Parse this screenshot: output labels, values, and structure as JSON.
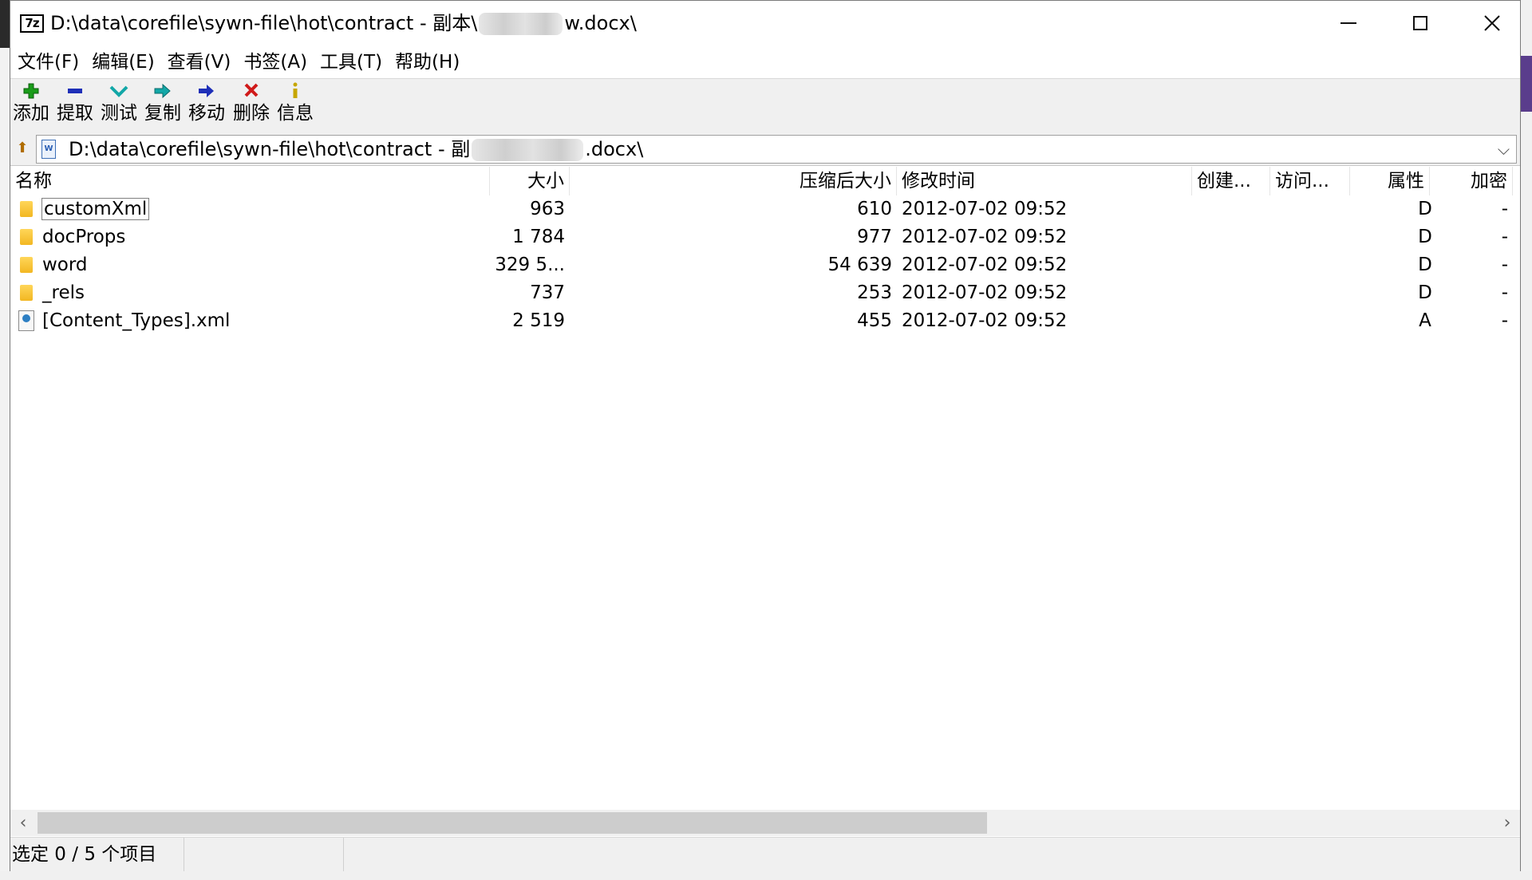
{
  "window": {
    "title_prefix": "D:\\data\\corefile\\sywn-file\\hot\\contract - 副本\\",
    "title_suffix": "w.docx\\",
    "app_icon": "7z"
  },
  "menu": [
    "文件(F)",
    "编辑(E)",
    "查看(V)",
    "书签(A)",
    "工具(T)",
    "帮助(H)"
  ],
  "toolbar": [
    {
      "label": "添加",
      "icon": "plus-icon",
      "color": "#1a9c1a"
    },
    {
      "label": "提取",
      "icon": "minus-icon",
      "color": "#1e2fb8"
    },
    {
      "label": "测试",
      "icon": "check-down-icon",
      "color": "#12a7a7"
    },
    {
      "label": "复制",
      "icon": "copy-arrow-icon",
      "color": "#12a7a7"
    },
    {
      "label": "移动",
      "icon": "arrow-right-icon",
      "color": "#1e2fb8"
    },
    {
      "label": "删除",
      "icon": "delete-x-icon",
      "color": "#d01a1a"
    },
    {
      "label": "信息",
      "icon": "info-icon",
      "color": "#c6a600"
    }
  ],
  "address": {
    "prefix": "D:\\data\\corefile\\sywn-file\\hot\\contract - 副",
    "suffix": ".docx\\"
  },
  "columns": [
    "名称",
    "大小",
    "压缩后大小",
    "修改时间",
    "创建...",
    "访问...",
    "属性",
    "加密"
  ],
  "rows": [
    {
      "name": "customXml",
      "size": "963",
      "packed": "610",
      "modified": "2012-07-02 09:52",
      "created": "",
      "accessed": "",
      "attr": "D",
      "encrypted": "-",
      "type": "folder"
    },
    {
      "name": "docProps",
      "size": "1 784",
      "packed": "977",
      "modified": "2012-07-02 09:52",
      "created": "",
      "accessed": "",
      "attr": "D",
      "encrypted": "-",
      "type": "folder"
    },
    {
      "name": "word",
      "size": "329 5...",
      "packed": "54 639",
      "modified": "2012-07-02 09:52",
      "created": "",
      "accessed": "",
      "attr": "D",
      "encrypted": "-",
      "type": "folder"
    },
    {
      "name": "_rels",
      "size": "737",
      "packed": "253",
      "modified": "2012-07-02 09:52",
      "created": "",
      "accessed": "",
      "attr": "D",
      "encrypted": "-",
      "type": "folder"
    },
    {
      "name": "[Content_Types].xml",
      "size": "2 519",
      "packed": "455",
      "modified": "2012-07-02 09:52",
      "created": "",
      "accessed": "",
      "attr": "A",
      "encrypted": "-",
      "type": "xml"
    }
  ],
  "status": {
    "selection": "选定 0 / 5 个项目"
  }
}
